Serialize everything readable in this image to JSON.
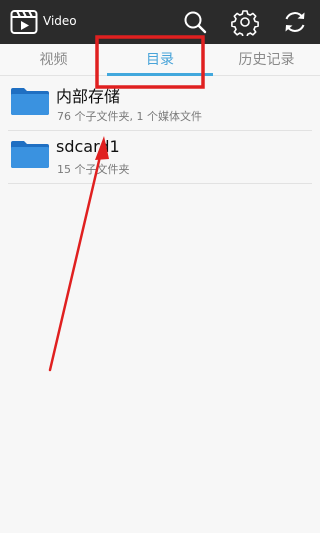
{
  "header": {
    "app_title": "Video",
    "actions": [
      {
        "icon": "search-icon"
      },
      {
        "icon": "gear-icon"
      },
      {
        "icon": "refresh-icon"
      }
    ]
  },
  "tabs": [
    {
      "label": "视频",
      "active": false
    },
    {
      "label": "目录",
      "active": true
    },
    {
      "label": "历史记录",
      "active": false
    }
  ],
  "folders": [
    {
      "name": "内部存储",
      "detail": "76 个子文件夹, 1 个媒体文件"
    },
    {
      "name": "sdcard1",
      "detail": "15 个子文件夹"
    }
  ],
  "colors": {
    "topbar": "#2b2b2b",
    "accent": "#42a8dd",
    "active_tab_text": "#49a4d9",
    "folder_blue": "#2f86d8",
    "annotation_red": "#e02020"
  }
}
